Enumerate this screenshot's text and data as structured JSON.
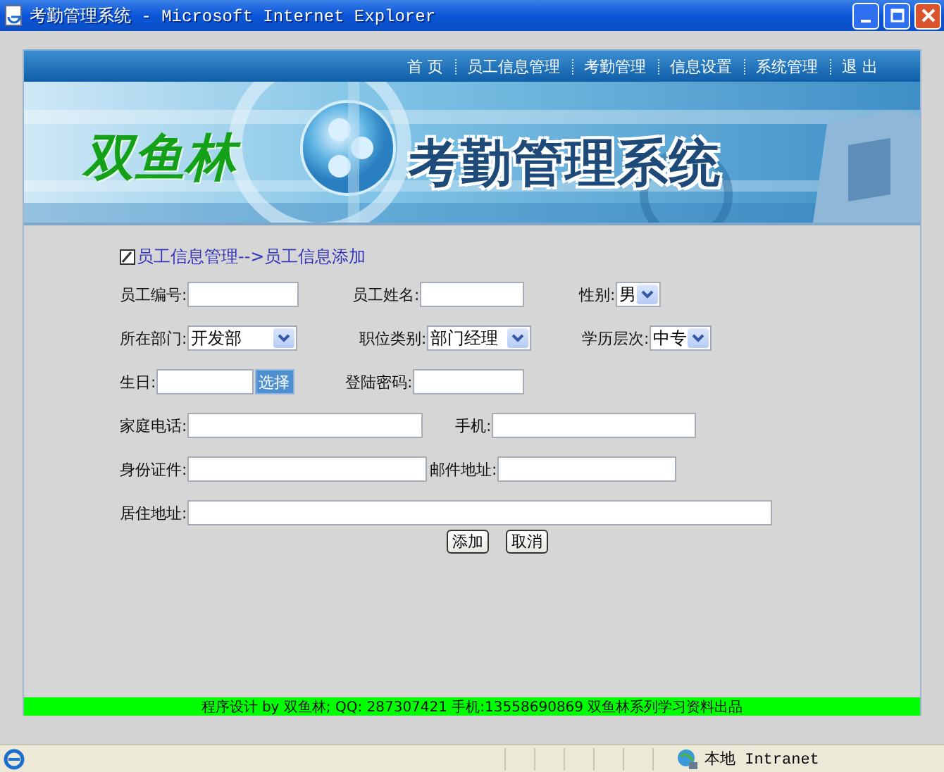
{
  "window": {
    "title": "考勤管理系统 - Microsoft Internet Explorer"
  },
  "nav": [
    {
      "label": "首 页"
    },
    {
      "label": "员工信息管理"
    },
    {
      "label": "考勤管理"
    },
    {
      "label": "信息设置"
    },
    {
      "label": "系统管理"
    },
    {
      "label": "退 出"
    }
  ],
  "banner": {
    "logo_text": "双鱼林",
    "title": "考勤管理系统"
  },
  "breadcrumb": "员工信息管理-->员工信息添加",
  "form": {
    "rows": [
      {
        "fields": [
          {
            "kind": "text",
            "label": "员工编号:"
          },
          {
            "kind": "text",
            "label": "员工姓名:"
          },
          {
            "kind": "select",
            "label": "性别:",
            "value": "男"
          }
        ]
      },
      {
        "fields": [
          {
            "kind": "select",
            "label": "所在部门:",
            "value": "开发部"
          },
          {
            "kind": "select",
            "label": "职位类别:",
            "value": "部门经理"
          },
          {
            "kind": "select",
            "label": "学历层次:",
            "value": "中专"
          }
        ]
      },
      {
        "fields": [
          {
            "kind": "date",
            "label": "生日:",
            "button": "选择"
          },
          {
            "kind": "password",
            "label": "登陆密码:"
          }
        ]
      },
      {
        "fields": [
          {
            "kind": "text",
            "label": "家庭电话:"
          },
          {
            "kind": "text",
            "label": "手机:"
          }
        ]
      },
      {
        "fields": [
          {
            "kind": "text",
            "label": "身份证件:"
          },
          {
            "kind": "text",
            "label": "邮件地址:"
          }
        ]
      },
      {
        "fields": [
          {
            "kind": "text",
            "label": "居住地址:"
          }
        ]
      }
    ],
    "buttons": [
      "添加",
      "取消"
    ]
  },
  "footer": "程序设计 by 双鱼林; QQ: 287307421 手机:13558690869 双鱼林系列学习资料出品",
  "status_bar": {
    "zone": "本地 Intranet"
  }
}
